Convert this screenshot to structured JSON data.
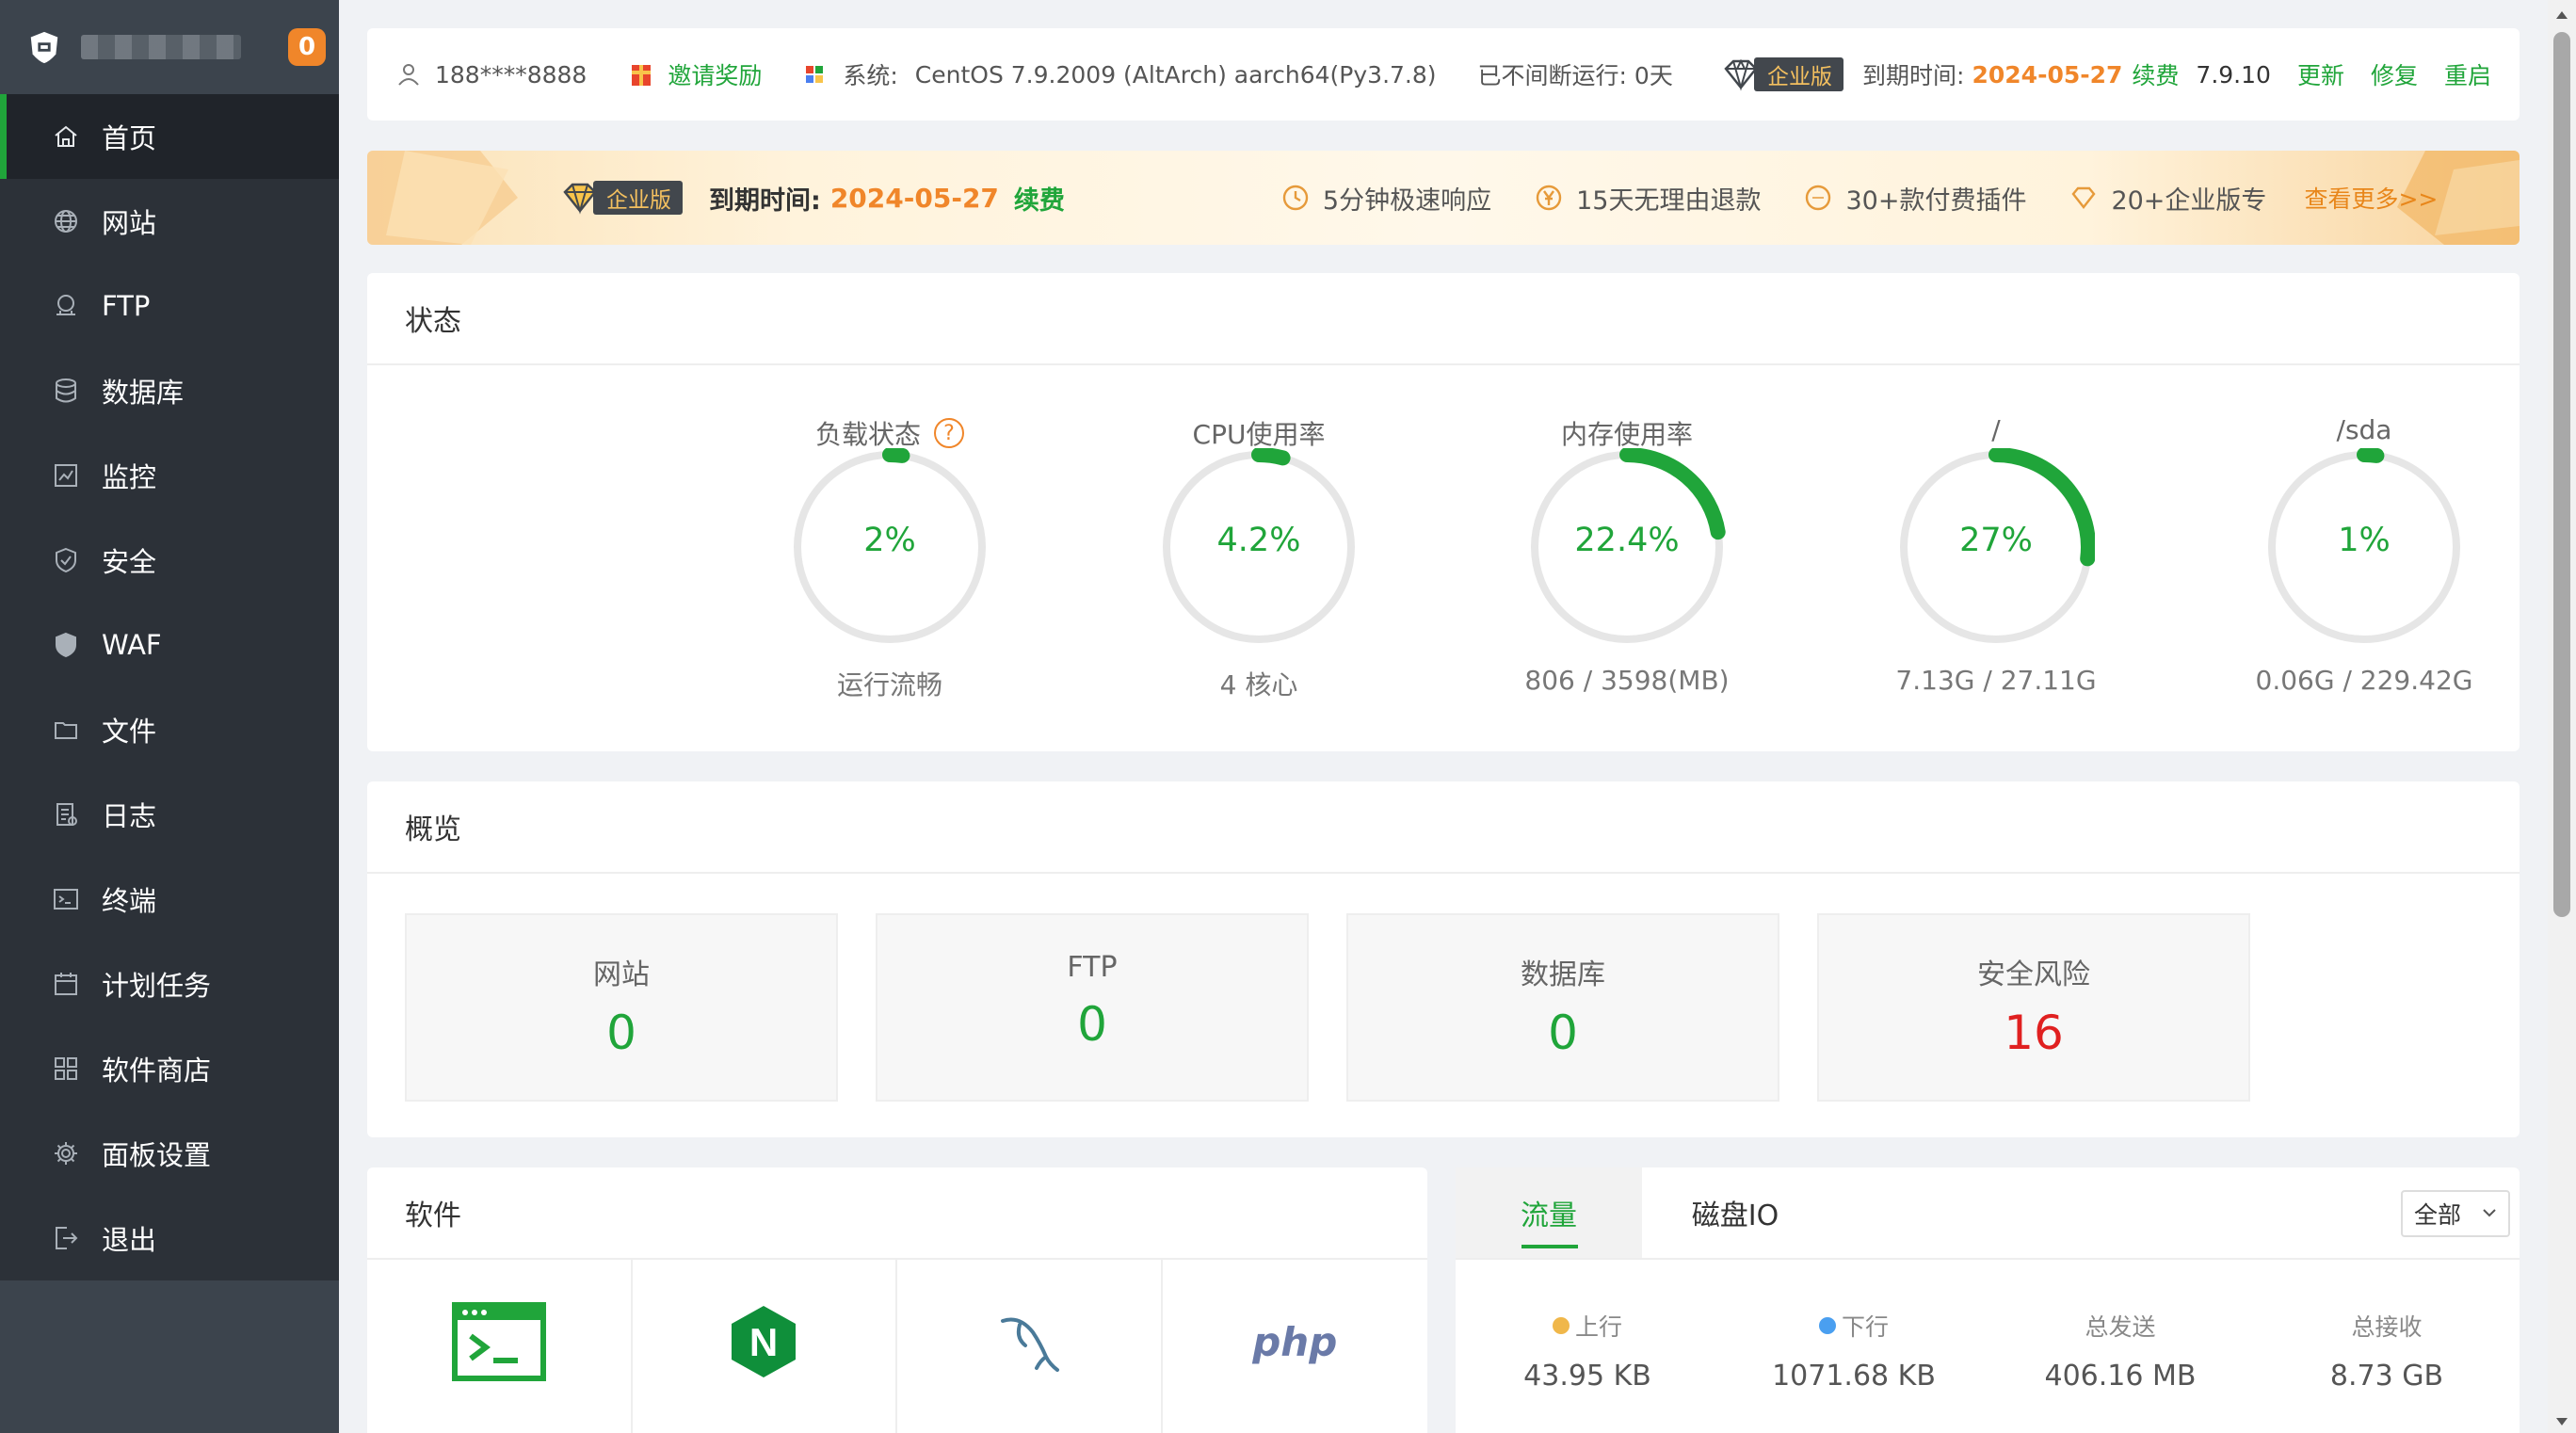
{
  "sidebar": {
    "badge": "0",
    "items": [
      {
        "label": "首页",
        "icon": "home-icon",
        "active": true
      },
      {
        "label": "网站",
        "icon": "globe-icon"
      },
      {
        "label": "FTP",
        "icon": "ftp-icon"
      },
      {
        "label": "数据库",
        "icon": "database-icon"
      },
      {
        "label": "监控",
        "icon": "monitor-icon"
      },
      {
        "label": "安全",
        "icon": "shield-check-icon"
      },
      {
        "label": "WAF",
        "icon": "shield-icon"
      },
      {
        "label": "文件",
        "icon": "folder-icon"
      },
      {
        "label": "日志",
        "icon": "log-icon"
      },
      {
        "label": "终端",
        "icon": "terminal-icon"
      },
      {
        "label": "计划任务",
        "icon": "calendar-icon"
      },
      {
        "label": "软件商店",
        "icon": "apps-icon"
      },
      {
        "label": "面板设置",
        "icon": "gear-icon"
      },
      {
        "label": "退出",
        "icon": "logout-icon"
      }
    ]
  },
  "topbar": {
    "user": "188****8888",
    "invite": "邀请奖励",
    "system_label": "系统:",
    "system_value": "CentOS 7.9.2009 (AltArch) aarch64(Py3.7.8)",
    "uptime": "已不间断运行: 0天",
    "edition": "企业版",
    "expire_label": "到期时间:",
    "expire_date": "2024-05-27",
    "renew": "续费",
    "version": "7.9.10",
    "update": "更新",
    "repair": "修复",
    "restart": "重启"
  },
  "banner": {
    "edition": "企业版",
    "expire_label": "到期时间:",
    "expire_date": "2024-05-27",
    "renew": "续费",
    "features": [
      "5分钟极速响应",
      "15天无理由退款",
      "30+款付费插件",
      "20+企业版专"
    ],
    "more": "查看更多>>"
  },
  "status": {
    "title": "状态",
    "gauges": [
      {
        "title": "负载状态",
        "value": "2%",
        "percent": 2,
        "sub": "运行流畅",
        "help": "?"
      },
      {
        "title": "CPU使用率",
        "value": "4.2%",
        "percent": 4.2,
        "sub": "4 核心"
      },
      {
        "title": "内存使用率",
        "value": "22.4%",
        "percent": 22.4,
        "sub": "806 / 3598(MB)"
      },
      {
        "title": "/",
        "value": "27%",
        "percent": 27,
        "sub": "7.13G / 27.11G"
      },
      {
        "title": "/sda",
        "value": "1%",
        "percent": 1,
        "sub": "0.06G / 229.42G"
      }
    ]
  },
  "overview": {
    "title": "概览",
    "boxes": [
      {
        "label": "网站",
        "value": "0"
      },
      {
        "label": "FTP",
        "value": "0"
      },
      {
        "label": "数据库",
        "value": "0"
      },
      {
        "label": "安全风险",
        "value": "16"
      }
    ]
  },
  "software": {
    "title": "软件",
    "php_label": "php",
    "nginx_letter": "N"
  },
  "traffic": {
    "tabs": [
      "流量",
      "磁盘IO"
    ],
    "select": "全部",
    "stats": [
      {
        "label": "上行",
        "value": "43.95 KB",
        "dot": "#f0b74a"
      },
      {
        "label": "下行",
        "value": "1071.68 KB",
        "dot": "#4a9ff0"
      },
      {
        "label": "总发送",
        "value": "406.16 MB"
      },
      {
        "label": "总接收",
        "value": "8.73 GB"
      }
    ]
  },
  "colors": {
    "accent": "#20a53a",
    "orange": "#f0862a",
    "danger": "#e02020",
    "sidebar": "#3c444d"
  }
}
